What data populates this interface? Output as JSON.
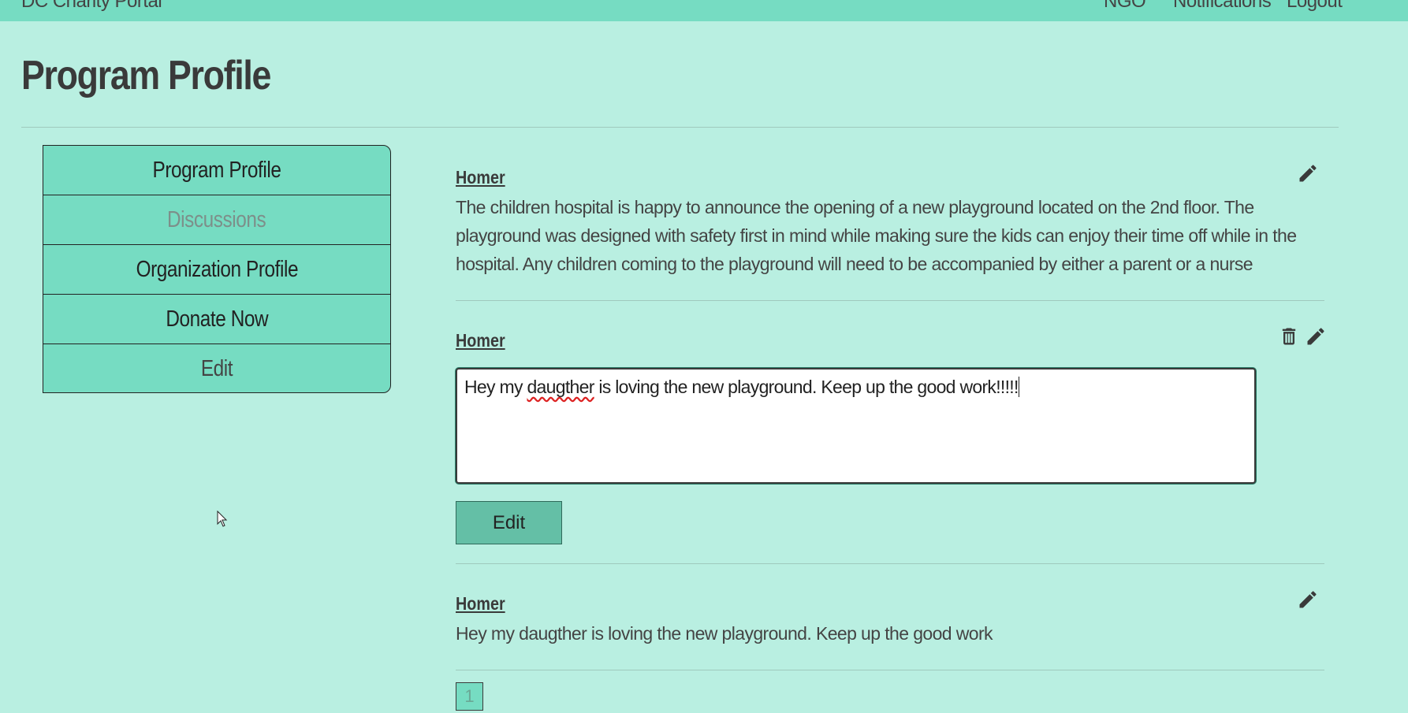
{
  "header": {
    "brand": "DC Charity Portal",
    "links": [
      "NGO",
      "Notifications",
      "Logout"
    ]
  },
  "page": {
    "title": "Program Profile"
  },
  "sidebar": {
    "items": [
      {
        "label": "Program Profile"
      },
      {
        "label": "Discussions"
      },
      {
        "label": "Organization Profile"
      },
      {
        "label": "Donate Now"
      },
      {
        "label": "Edit"
      }
    ]
  },
  "posts": [
    {
      "author": "Homer",
      "body": "The children hospital is happy to announce the opening of a new playground located on the 2nd floor. The playground was designed with safety first in mind while making sure the kids can enjoy their time off while in the hospital. Any children coming to the playground will need to be accompanied by either a parent or a nurse"
    },
    {
      "author": "Homer",
      "edit_value_before": "Hey my ",
      "edit_value_misspelled": "daugther",
      "edit_value_after": " is loving the new playground. Keep up the good work!!!!!",
      "submit_label": "Edit"
    },
    {
      "author": "Homer",
      "body": "Hey my daugther is loving the new playground. Keep up the good work"
    }
  ],
  "pagination": {
    "current": "1"
  },
  "icons": {
    "edit": "pencil-icon",
    "delete": "trash-icon"
  },
  "colors": {
    "background": "#b9efe1",
    "accent": "#76dcc2",
    "button": "#64bfa6"
  }
}
